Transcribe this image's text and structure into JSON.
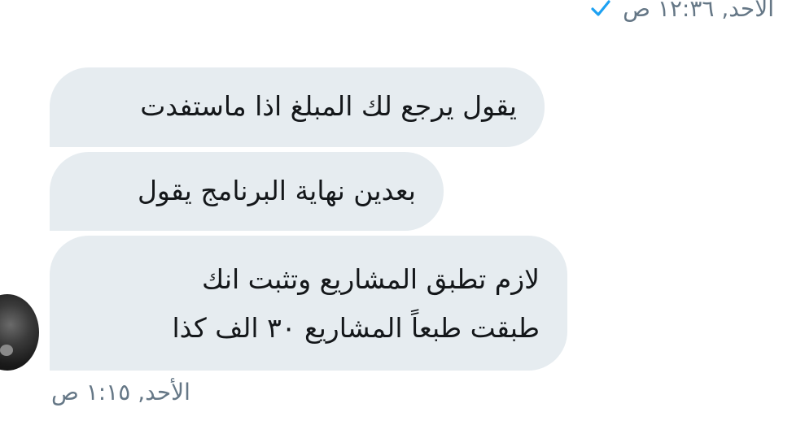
{
  "conversation": {
    "previous_timestamp": "الأحد, ١٢:٣٦ ص",
    "previous_status_icon": "check-icon",
    "messages": [
      {
        "lines": [
          "يقول يرجع لك المبلغ اذا ماستفدت"
        ]
      },
      {
        "lines": [
          "بعدين نهاية البرنامج يقول"
        ]
      },
      {
        "lines": [
          "لازم تطبق المشاريع وتثبت انك",
          "طبقت طبعاً المشاريع ٣٠ الف كذا"
        ]
      }
    ],
    "group_timestamp": "الأحد, ١:١٥ ص"
  },
  "colors": {
    "bubble_bg": "#e6ecf0",
    "meta_text": "#657786",
    "check": "#1da1f2"
  }
}
